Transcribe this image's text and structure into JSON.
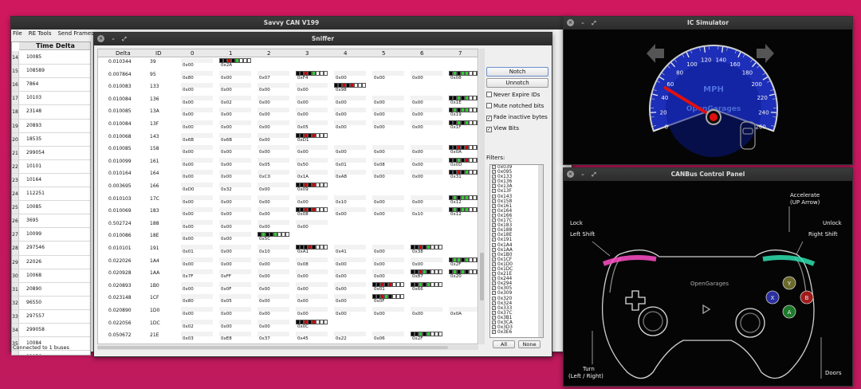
{
  "savvy": {
    "title": "Savvy CAN V199",
    "menu": [
      "File",
      "RE Tools",
      "Send Frames"
    ],
    "column_header": "Time Delta",
    "rows": [
      {
        "n": "14",
        "t": "10085"
      },
      {
        "n": "15",
        "t": "108589"
      },
      {
        "n": "16",
        "t": "7864"
      },
      {
        "n": "17",
        "t": "10103"
      },
      {
        "n": "18",
        "t": "23148"
      },
      {
        "n": "19",
        "t": "20893"
      },
      {
        "n": "20",
        "t": "18535"
      },
      {
        "n": "21",
        "t": "299054"
      },
      {
        "n": "22",
        "t": "10101"
      },
      {
        "n": "23",
        "t": "10164"
      },
      {
        "n": "24",
        "t": "112251"
      },
      {
        "n": "25",
        "t": "10085"
      },
      {
        "n": "26",
        "t": "3695"
      },
      {
        "n": "27",
        "t": "10099"
      },
      {
        "n": "28",
        "t": "297546"
      },
      {
        "n": "29",
        "t": "22026"
      },
      {
        "n": "30",
        "t": "10068"
      },
      {
        "n": "31",
        "t": "20890"
      },
      {
        "n": "32",
        "t": "96550"
      },
      {
        "n": "33",
        "t": "297557"
      },
      {
        "n": "34",
        "t": "299058"
      },
      {
        "n": "35",
        "t": "10084"
      },
      {
        "n": "36",
        "t": "22056"
      }
    ],
    "status": "Connected to 1 buses"
  },
  "sniffer": {
    "title": "Sniffer",
    "headers": {
      "delta": "Delta",
      "id": "ID",
      "cols": [
        "0",
        "1",
        "2",
        "3",
        "4",
        "5",
        "6",
        "7"
      ]
    },
    "rows": [
      {
        "delta": "0.010344",
        "id": "39",
        "b": [
          "0x00",
          "0x2A",
          "",
          "",
          "",
          "",
          "",
          ""
        ]
      },
      {
        "delta": "0.007864",
        "id": "95",
        "b": [
          "0x80",
          "0x00",
          "0x07",
          "0xF4",
          "0x00",
          "0x00",
          "0x00",
          "0x08"
        ]
      },
      {
        "delta": "0.010083",
        "id": "133",
        "b": [
          "0x00",
          "0x00",
          "0x00",
          "0x00",
          "0x98",
          "",
          "",
          ""
        ]
      },
      {
        "delta": "0.010084",
        "id": "136",
        "b": [
          "0x00",
          "0x02",
          "0x00",
          "0x00",
          "0x00",
          "0x00",
          "0x00",
          "0x1E"
        ]
      },
      {
        "delta": "0.010085",
        "id": "13A",
        "b": [
          "0x00",
          "0x00",
          "0x00",
          "0x00",
          "0x00",
          "0x00",
          "0x00",
          "0x19"
        ]
      },
      {
        "delta": "0.010084",
        "id": "13F",
        "b": [
          "0x00",
          "0x00",
          "0x00",
          "0x05",
          "0x00",
          "0x00",
          "0x00",
          "0x1F"
        ]
      },
      {
        "delta": "0.010068",
        "id": "143",
        "b": [
          "0x6B",
          "0x6B",
          "0x00",
          "0xD1",
          "",
          "",
          "",
          ""
        ]
      },
      {
        "delta": "0.010085",
        "id": "158",
        "b": [
          "0x00",
          "0x00",
          "0x00",
          "0x00",
          "0x00",
          "0x00",
          "0x00",
          "0x0A"
        ]
      },
      {
        "delta": "0.010099",
        "id": "161",
        "b": [
          "0x00",
          "0x00",
          "0x05",
          "0x50",
          "0x01",
          "0x08",
          "0x00",
          "0x0D"
        ]
      },
      {
        "delta": "0.010164",
        "id": "164",
        "b": [
          "0x00",
          "0x00",
          "0xC0",
          "0x1A",
          "0xA8",
          "0x00",
          "0x00",
          "0x31"
        ]
      },
      {
        "delta": "0.003695",
        "id": "166",
        "b": [
          "0xD0",
          "0x32",
          "0x00",
          "0x09",
          "",
          "",
          "",
          ""
        ]
      },
      {
        "delta": "0.010103",
        "id": "17C",
        "b": [
          "0x00",
          "0x00",
          "0x00",
          "0x00",
          "0x10",
          "0x00",
          "0x00",
          "0x12"
        ]
      },
      {
        "delta": "0.010069",
        "id": "183",
        "b": [
          "0x00",
          "0x00",
          "0x00",
          "0x08",
          "0x00",
          "0x00",
          "0x10",
          "0x12"
        ]
      },
      {
        "delta": "0.502724",
        "id": "188",
        "b": [
          "0x00",
          "0x00",
          "0x00",
          "0x00",
          "",
          "",
          "",
          ""
        ]
      },
      {
        "delta": "0.010086",
        "id": "18E",
        "b": [
          "0x00",
          "0x00",
          "0x5C",
          "",
          "",
          "",
          "",
          ""
        ]
      },
      {
        "delta": "0.010101",
        "id": "191",
        "b": [
          "0x01",
          "0x00",
          "0x10",
          "0xA1",
          "0x41",
          "0x00",
          "0x38",
          ""
        ]
      },
      {
        "delta": "0.022026",
        "id": "1A4",
        "b": [
          "0x00",
          "0x00",
          "0x00",
          "0x08",
          "0x00",
          "0x00",
          "0x00",
          "0x2F"
        ]
      },
      {
        "delta": "0.020928",
        "id": "1AA",
        "b": [
          "0x7F",
          "0xFF",
          "0x00",
          "0x00",
          "0x00",
          "0x00",
          "0x87",
          "0x20"
        ]
      },
      {
        "delta": "0.020893",
        "id": "1B0",
        "b": [
          "0x00",
          "0x0F",
          "0x00",
          "0x00",
          "0x00",
          "0x01",
          "0x66",
          ""
        ]
      },
      {
        "delta": "0.023148",
        "id": "1CF",
        "b": [
          "0x80",
          "0x05",
          "0x00",
          "0x00",
          "0x00",
          "0x0F",
          "",
          ""
        ]
      },
      {
        "delta": "0.020890",
        "id": "1D0",
        "b": [
          "0x00",
          "0x00",
          "0x00",
          "0x00",
          "0x00",
          "0x00",
          "0x00",
          "0x0A"
        ]
      },
      {
        "delta": "0.022056",
        "id": "1DC",
        "b": [
          "0x02",
          "0x00",
          "0x00",
          "0x0C",
          "",
          "",
          "",
          ""
        ]
      },
      {
        "delta": "0.050672",
        "id": "21E",
        "b": [
          "0x03",
          "0xE8",
          "0x37",
          "0x45",
          "0x22",
          "0x06",
          "0x2F",
          ""
        ]
      }
    ],
    "buttons": {
      "notch": "Notch",
      "unnotch": "Unnotch",
      "all": "All",
      "none": "None"
    },
    "options": [
      {
        "label": "Never Expire IDs",
        "checked": false
      },
      {
        "label": "Mute notched bits",
        "checked": false
      },
      {
        "label": "Fade inactive bytes",
        "checked": true
      },
      {
        "label": "View Bits",
        "checked": true
      }
    ],
    "filters_label": "Filters:",
    "filters": [
      "0x039",
      "0x095",
      "0x133",
      "0x136",
      "0x13A",
      "0x13F",
      "0x143",
      "0x158",
      "0x161",
      "0x164",
      "0x166",
      "0x17C",
      "0x183",
      "0x188",
      "0x18E",
      "0x191",
      "0x1A4",
      "0x1AA",
      "0x1B0",
      "0x1CF",
      "0x1D0",
      "0x1DC",
      "0x21E",
      "0x244",
      "0x294",
      "0x305",
      "0x309",
      "0x320",
      "0x324",
      "0x333",
      "0x37C",
      "0x3B1",
      "0x3CA",
      "0x3D3",
      "0x3E6"
    ]
  },
  "ic": {
    "title": "IC Simulator",
    "unit": "MPH",
    "brand": "OpenGarages",
    "ticks": [
      "0",
      "20",
      "40",
      "60",
      "80",
      "100",
      "120",
      "140",
      "160",
      "180",
      "200",
      "220",
      "240",
      "260"
    ],
    "speed_fraction": 0.2
  },
  "cbp": {
    "title": "CANBus Control Panel",
    "accelerate": "Accelerate",
    "up_arrow": "(UP Arrow)",
    "lock": "Lock",
    "left_shift": "Left Shift",
    "unlock": "Unlock",
    "right_shift": "Right Shift",
    "brand": "OpenGarages",
    "turn": "Turn",
    "left_right": "(Left / Right)",
    "doors": "Doors",
    "btn_y": "Y",
    "btn_x": "X",
    "btn_b": "B",
    "btn_a": "A"
  },
  "colors": {
    "desktop": "#c81a5c",
    "gauge_blue": "#1d2fb8",
    "active_red": "#cc0000",
    "active_green": "#33cc33",
    "trigger_pink": "#ff4fc8",
    "trigger_teal": "#2fe0b0"
  }
}
